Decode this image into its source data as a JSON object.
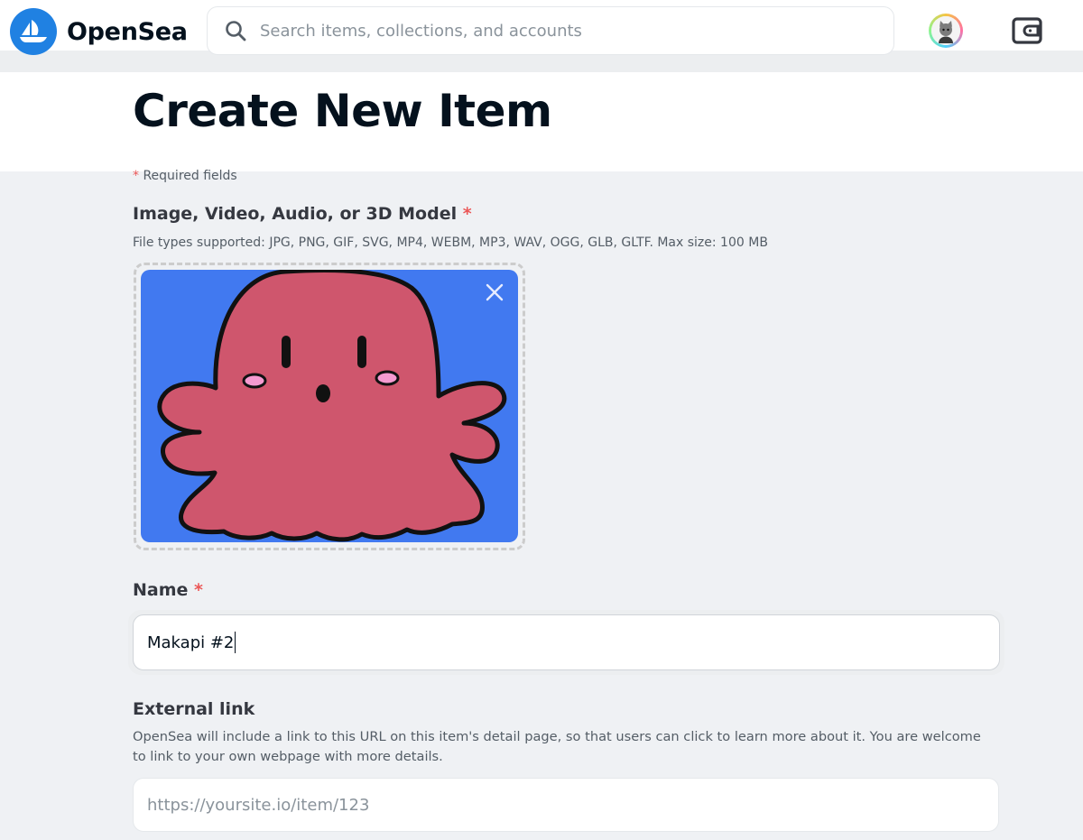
{
  "navbar": {
    "brand": "OpenSea",
    "search_placeholder": "Search items, collections, and accounts",
    "icons": [
      "opensea-logo-icon",
      "search-icon",
      "avatar",
      "wallet-icon"
    ]
  },
  "page": {
    "title": "Create New Item",
    "required_marker": "*",
    "required_note": "Required fields"
  },
  "media": {
    "label": "Image, Video, Audio, or 3D Model",
    "hint": "File types supported: JPG, PNG, GIF, SVG, MP4, WEBM, MP3, WAV, OGG, GLB, GLTF. Max size: 100 MB",
    "preview_background": "#4179f0",
    "preview_character_color": "#cf566d"
  },
  "name_field": {
    "label": "Name",
    "value": "Makapi #2"
  },
  "external_link": {
    "label": "External link",
    "hint_line1": "OpenSea will include a link to this URL on this item's detail page, so that users can click to learn more about it. You are welcome",
    "hint_line2": "to link to your own webpage with more details.",
    "placeholder": "https://yoursite.io/item/123"
  },
  "colors": {
    "brand_blue": "#2081e2",
    "required_red": "#eb5757",
    "page_bg": "#eff1f4"
  }
}
